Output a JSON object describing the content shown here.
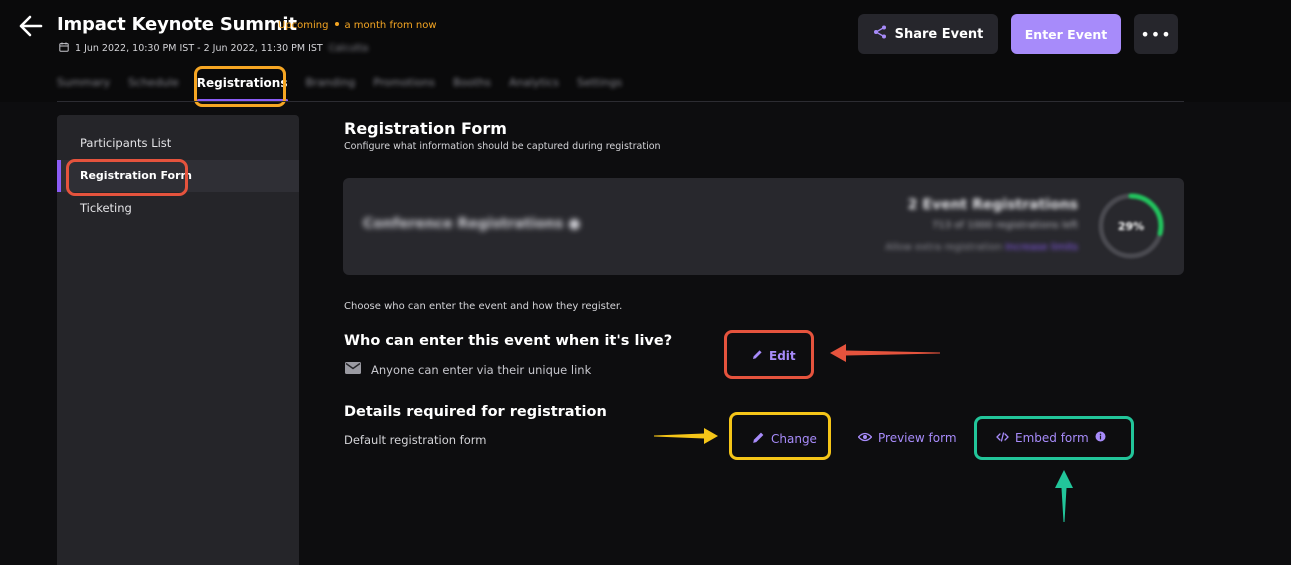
{
  "header": {
    "title": "Impact Keynote Summit",
    "status": "Upcoming",
    "status_when": "a month from now",
    "date_range": "1 Jun 2022, 10:30 PM IST - 2 Jun 2022, 11:30 PM IST",
    "timezone_blurred": "Calcutta",
    "share_label": "Share Event",
    "enter_label": "Enter Event",
    "more_label": "•••"
  },
  "tabs": [
    {
      "label": "Summary",
      "blurred": true
    },
    {
      "label": "Schedule",
      "blurred": true
    },
    {
      "label": "Registrations",
      "active": true
    },
    {
      "label": "Branding",
      "blurred": true
    },
    {
      "label": "Promotions",
      "blurred": true
    },
    {
      "label": "Booths",
      "blurred": true
    },
    {
      "label": "Analytics",
      "blurred": true
    },
    {
      "label": "Settings",
      "blurred": true
    }
  ],
  "sidebar": {
    "items": [
      {
        "label": "Participants List"
      },
      {
        "label": "Registration Form",
        "active": true
      },
      {
        "label": "Ticketing"
      }
    ]
  },
  "main": {
    "title": "Registration Form",
    "subtitle": "Configure what information should be captured during registration",
    "conference_card": {
      "title": "Conference Registrations",
      "registrations_line": "2 Event Registrations",
      "capacity_line": "713 of 1000 registrations left",
      "allow_line": "Allow extra registration",
      "allow_link": "Increase limits",
      "ring_label": "29%",
      "ring_progress": 0.29
    },
    "choose_text": "Choose who can enter the event and how they register.",
    "who_title": "Who can enter this event when it's live?",
    "who_desc": "Anyone can enter via their unique link",
    "edit_label": "Edit",
    "details_title": "Details required for registration",
    "details_desc": "Default registration form",
    "change_label": "Change",
    "preview_label": "Preview form",
    "embed_label": "Embed form"
  },
  "colors": {
    "accent": "#a78bfa",
    "status_orange": "#f5a623",
    "highlight_orange": "#f6a623",
    "highlight_red": "#e5533d",
    "highlight_yellow": "#f5c518",
    "highlight_green": "#22c59a",
    "ring_green": "#22c55e"
  }
}
